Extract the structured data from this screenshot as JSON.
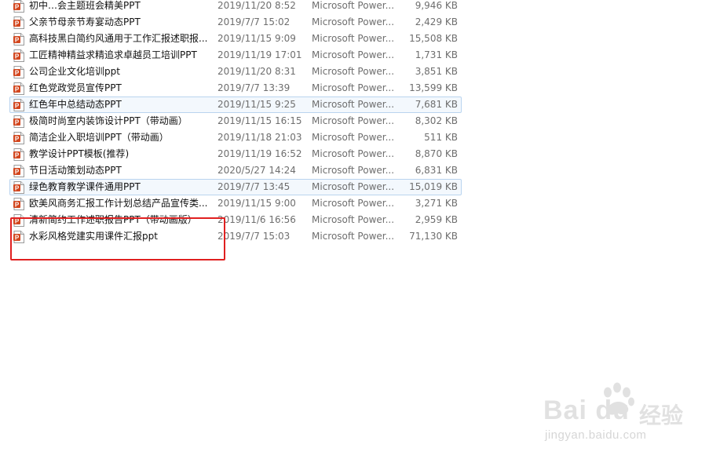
{
  "files": [
    {
      "name": "初中…会主题班会精美PPT",
      "date": "2019/11/20 8:52",
      "type": "Microsoft Power...",
      "size": "9,946 KB",
      "selected": false
    },
    {
      "name": "父亲节母亲节寿宴动态PPT",
      "date": "2019/7/7 15:02",
      "type": "Microsoft Power...",
      "size": "2,429 KB",
      "selected": false
    },
    {
      "name": "高科技黑白简约风通用于工作汇报述职报...",
      "date": "2019/11/15 9:09",
      "type": "Microsoft Power...",
      "size": "15,508 KB",
      "selected": false
    },
    {
      "name": "工匠精神精益求精追求卓越员工培训PPT",
      "date": "2019/11/19 17:01",
      "type": "Microsoft Power...",
      "size": "1,731 KB",
      "selected": false
    },
    {
      "name": "公司企业文化培训ppt",
      "date": "2019/11/20 8:31",
      "type": "Microsoft Power...",
      "size": "3,851 KB",
      "selected": false
    },
    {
      "name": "红色党政党员宣传PPT",
      "date": "2019/7/7 13:39",
      "type": "Microsoft Power...",
      "size": "13,599 KB",
      "selected": false
    },
    {
      "name": "红色年中总结动态PPT",
      "date": "2019/11/15 9:25",
      "type": "Microsoft Power...",
      "size": "7,681 KB",
      "selected": true
    },
    {
      "name": "极简时尚室内装饰设计PPT（带动画）",
      "date": "2019/11/15 16:15",
      "type": "Microsoft Power...",
      "size": "8,302 KB",
      "selected": false
    },
    {
      "name": "简洁企业入职培训PPT（带动画）",
      "date": "2019/11/18 21:03",
      "type": "Microsoft Power...",
      "size": "511 KB",
      "selected": false
    },
    {
      "name": "教学设计PPT模板(推荐)",
      "date": "2019/11/19 16:52",
      "type": "Microsoft Power...",
      "size": "8,870 KB",
      "selected": false
    },
    {
      "name": "节日活动策划动态PPT",
      "date": "2020/5/27 14:24",
      "type": "Microsoft Power...",
      "size": "6,831 KB",
      "selected": false
    },
    {
      "name": "绿色教育教学课件通用PPT",
      "date": "2019/7/7 13:45",
      "type": "Microsoft Power...",
      "size": "15,019 KB",
      "selected": true
    },
    {
      "name": "欧美风商务汇报工作计划总结产品宣传类...",
      "date": "2019/11/15 9:00",
      "type": "Microsoft Power...",
      "size": "3,271 KB",
      "selected": false
    },
    {
      "name": "清新简约工作述职报告PPT（带动画版）",
      "date": "2019/11/6 16:56",
      "type": "Microsoft Power...",
      "size": "2,959 KB",
      "selected": false
    },
    {
      "name": "水彩风格党建实用课件汇报ppt",
      "date": "2019/7/7 15:03",
      "type": "Microsoft Power...",
      "size": "71,130 KB",
      "selected": false
    }
  ],
  "icons": {
    "file": "powerpoint-file-icon",
    "accent": "#d2471f"
  },
  "highlight": {
    "color": "#e02020"
  },
  "watermark": {
    "logo": "Bai du",
    "cn": "经验",
    "url": "jingyan.baidu.com"
  }
}
